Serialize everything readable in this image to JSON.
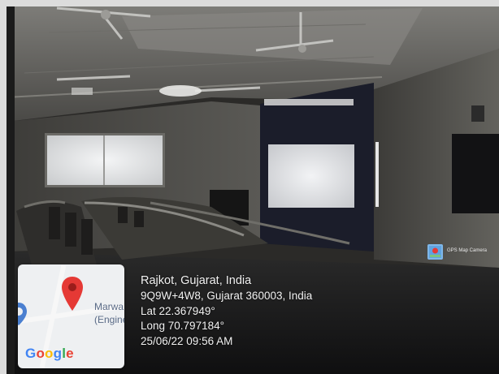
{
  "overlay": {
    "address_title": "Rajkot, Gujarat, India",
    "address_line": "9Q9W+4W8, Gujarat 360003, India",
    "latitude": "Lat 22.367949°",
    "longitude": "Long 70.797184°",
    "datetime": "25/06/22 09:56 AM"
  },
  "map": {
    "label_lines": [
      "Marwa",
      "(Engine"
    ],
    "brand": "Google",
    "pin_color": "#e53935"
  },
  "camera_badge": {
    "label": "GPS Map Camera"
  }
}
